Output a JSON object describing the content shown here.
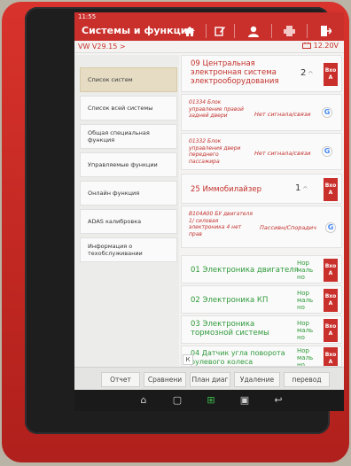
{
  "statusbar": {
    "time": "11:55"
  },
  "titlebar": {
    "title": "Системы и функции",
    "icons": [
      "home-icon",
      "edit-icon",
      "user-icon",
      "print-icon",
      "exit-icon"
    ]
  },
  "subbar": {
    "version": "VW V29.15 >",
    "voltage": "12.20V"
  },
  "sidebar": {
    "items": [
      {
        "label": "Список систем"
      },
      {
        "label": "Список всей системы"
      },
      {
        "label": "Общая специальная функция"
      },
      {
        "label": "Управляемые функции"
      },
      {
        "label": "Онлайн функция"
      },
      {
        "label": "ADAS калибровка"
      },
      {
        "label": "Информация о техобслуживании"
      }
    ]
  },
  "rows": {
    "r1": {
      "name": "09 Центральная электронная система электрооборудования",
      "count": "2",
      "action": "Вхо А"
    },
    "s1": {
      "name": "01334 Блок управление правой задней двери",
      "status": "Нет сигнала/связи"
    },
    "s2": {
      "name": "01332 Блок управления двери переднего пассажира",
      "status": "Нет сигнала/связи"
    },
    "r2": {
      "name": "25 Иммобилайзер",
      "count": "1",
      "action": "Вхо А"
    },
    "s3": {
      "name": "B104A00 БУ двигателя 1/ силовая электроника 4 нет прав",
      "status": "Пассивн/Спорадич"
    },
    "g1": {
      "name": "01 Электроника двигателя",
      "status": "Нор маль но",
      "action": "Вхо А"
    },
    "g2": {
      "name": "02 Электроника КП",
      "status": "Нор маль но",
      "action": "Вхо А"
    },
    "g3": {
      "name": "03 Электроника тормозной системы",
      "status": "Нор маль но",
      "action": "Вхо А"
    },
    "g4": {
      "name": "04 Датчик угла поворота рулевого колеса",
      "status": "Нор маль но",
      "action": "Вхо А"
    }
  },
  "bottombar": {
    "collapse": "К",
    "report": "Отчет",
    "compare": "Сравнени",
    "plan": "План диаг",
    "delete": "Удаление",
    "translate": "перевод"
  },
  "colors": {
    "brand_red": "#c92f2b",
    "ok_green": "#2f9a3a",
    "device_red": "#d8332c"
  }
}
